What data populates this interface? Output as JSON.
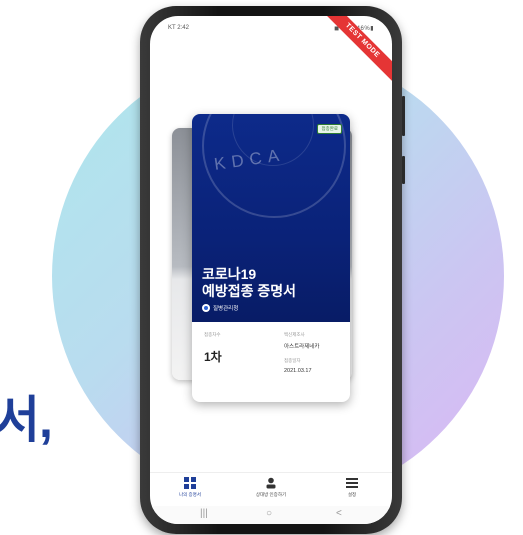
{
  "side_text": "서,",
  "status_bar": {
    "time": "KT 2:42",
    "right": "◼ ≋ ◢ 46%▮"
  },
  "ribbon_text": "TEST MODE",
  "card": {
    "watermark": "KDCA",
    "badge": "접종완료",
    "title_line1": "코로나19",
    "title_line2": "예방접종 증명서",
    "agency": "질병관리청",
    "dose_label": "접종차수",
    "dose_value": "1차",
    "vaccine_label": "백신제조사",
    "vaccine_value": "아스트라제네카",
    "date_label": "접종일자",
    "date_value": "2021.03.17"
  },
  "tabs": [
    {
      "label": "나의 증명서",
      "icon": "grid-icon"
    },
    {
      "label": "상대방 인증하기",
      "icon": "person-icon"
    },
    {
      "label": "설정",
      "icon": "menu-icon"
    }
  ],
  "navbar": {
    "recent": "|||",
    "home": "○",
    "back": "<"
  },
  "colors": {
    "accent": "#0a2278",
    "brand_text": "#1f3f99",
    "ribbon": "#e53535"
  }
}
